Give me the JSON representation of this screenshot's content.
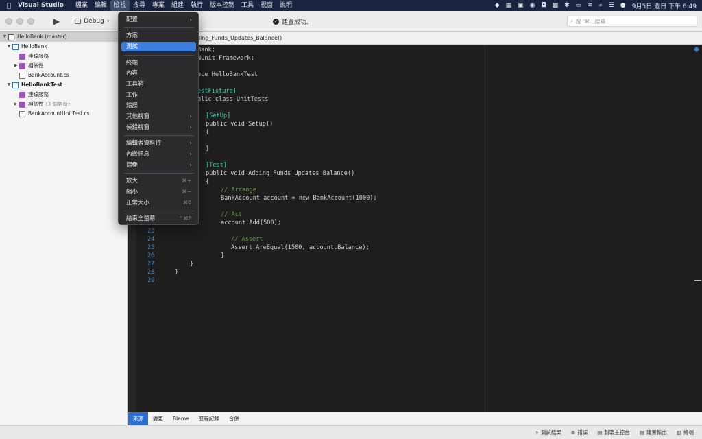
{
  "menubar": {
    "apple": "",
    "app_name": "Visual Studio",
    "menus": [
      "檔案",
      "編輯",
      "檢視",
      "搜尋",
      "專案",
      "組建",
      "執行",
      "版本控制",
      "工具",
      "視窗",
      "說明"
    ],
    "clock": "9月5日 週日 下午 6:49"
  },
  "toolbar": {
    "config": "Debug",
    "status": "建置成功。",
    "search_placeholder": "按 '⌘.' 搜尋"
  },
  "sidebar": {
    "items": [
      {
        "label": "HelloBank (master)",
        "note": ""
      },
      {
        "label": "HelloBank",
        "note": ""
      },
      {
        "label": "連線服務",
        "note": ""
      },
      {
        "label": "相依性",
        "note": ""
      },
      {
        "label": "BankAccount.cs",
        "note": ""
      },
      {
        "label": "HelloBankTest",
        "note": ""
      },
      {
        "label": "連線服務",
        "note": ""
      },
      {
        "label": "相依性",
        "note": "(3 個更新)"
      },
      {
        "label": "BankAccountUnitTest.cs",
        "note": ""
      }
    ]
  },
  "editor": {
    "tab_title": "ding_Funds_Updates_Balance()",
    "lines": [
      {
        "n": "",
        "text": "Bank;"
      },
      {
        "n": "",
        "text": "NUnit.Framework;"
      },
      {
        "n": "",
        "text": ""
      },
      {
        "n": "",
        "text": "ace HelloBankTest"
      },
      {
        "n": "",
        "text": ""
      },
      {
        "n": "",
        "text": "estFixture]"
      },
      {
        "n": "",
        "text": "blic class UnitTests"
      },
      {
        "n": "",
        "text": ""
      },
      {
        "n": "",
        "text": "[SetUp]"
      },
      {
        "n": "",
        "text": "public void Setup()"
      },
      {
        "n": "",
        "text": "{"
      },
      {
        "n": "",
        "text": ""
      },
      {
        "n": "",
        "text": "}"
      },
      {
        "n": "",
        "text": ""
      },
      {
        "n": "",
        "text": "[Test]"
      },
      {
        "n": "",
        "text": "public void Adding_Funds_Updates_Balance()"
      },
      {
        "n": "",
        "text": "{"
      },
      {
        "n": "",
        "text": "// Arrange"
      },
      {
        "n": "",
        "text": "BankAccount account = new BankAccount(1000);"
      },
      {
        "n": "",
        "text": ""
      },
      {
        "n": "",
        "text": "// Act"
      },
      {
        "n": "",
        "text": "account.Add(500);"
      },
      {
        "n": "23",
        "text": ""
      },
      {
        "n": "24",
        "text": "// Assert"
      },
      {
        "n": "25",
        "text": "Assert.AreEqual(1500, account.Balance);"
      },
      {
        "n": "26",
        "text": "}"
      },
      {
        "n": "27",
        "text": "}"
      },
      {
        "n": "28",
        "text": "}"
      },
      {
        "n": "29",
        "text": ""
      }
    ]
  },
  "bottom_tabs": [
    "來源",
    "變更",
    "Blame",
    "歷程記錄",
    "合併"
  ],
  "statusbar": [
    "測試結果",
    "錯誤",
    "封裝主控台",
    "建置輸出",
    "終端"
  ],
  "menu": {
    "items": [
      {
        "label": "配置",
        "submenu": true,
        "shortcut": ""
      },
      {
        "label": "方案",
        "submenu": false,
        "shortcut": ""
      },
      {
        "label": "測試",
        "submenu": false,
        "shortcut": ""
      },
      {
        "label": "終端",
        "submenu": false,
        "shortcut": ""
      },
      {
        "label": "內容",
        "submenu": false,
        "shortcut": ""
      },
      {
        "label": "工具箱",
        "submenu": false,
        "shortcut": ""
      },
      {
        "label": "工作",
        "submenu": false,
        "shortcut": ""
      },
      {
        "label": "錯誤",
        "submenu": false,
        "shortcut": ""
      },
      {
        "label": "其他視窗",
        "submenu": true,
        "shortcut": ""
      },
      {
        "label": "偵錯視窗",
        "submenu": true,
        "shortcut": ""
      },
      {
        "label": "編輯者資料行",
        "submenu": true,
        "shortcut": ""
      },
      {
        "label": "內嵌訊息",
        "submenu": true,
        "shortcut": ""
      },
      {
        "label": "摺疊",
        "submenu": true,
        "shortcut": ""
      },
      {
        "label": "放大",
        "submenu": false,
        "shortcut": "⌘+"
      },
      {
        "label": "縮小",
        "submenu": false,
        "shortcut": "⌘−"
      },
      {
        "label": "正常大小",
        "submenu": false,
        "shortcut": "⌘0"
      },
      {
        "label": "結束全螢幕",
        "submenu": false,
        "shortcut": "^⌘F"
      }
    ]
  },
  "colors": {
    "accent": "#3b7fe0",
    "menubar": "#1a2440",
    "editor_bg": "#1e1e1e"
  }
}
